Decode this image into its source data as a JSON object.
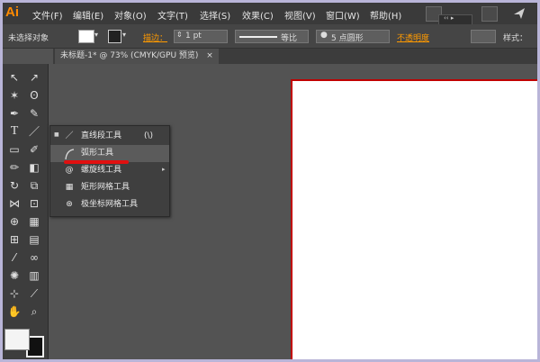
{
  "app": {
    "logo": "Ai",
    "cc_top": "‹‹ ▸",
    "cc_icon_label": "∞"
  },
  "menu": {
    "items": [
      "文件(F)",
      "编辑(E)",
      "对象(O)",
      "文字(T)",
      "选择(S)",
      "效果(C)",
      "视图(V)",
      "窗口(W)",
      "帮助(H)"
    ]
  },
  "control_bar": {
    "selection_status": "未选择对象",
    "stroke_label": "描边：",
    "stroke_value": "1 pt",
    "profile_label": "等比",
    "brush_label": "5 点圆形",
    "opacity_label": "不透明度",
    "style_label": "样式："
  },
  "document_tab": {
    "title": "未标题-1* @ 73% (CMYK/GPU 预览)",
    "close": "×"
  },
  "flyout": {
    "items": [
      {
        "label": "直线段工具",
        "shortcut": "(\\)",
        "icon": "line-segment-icon"
      },
      {
        "label": "弧形工具",
        "shortcut": "",
        "icon": "arc-icon"
      },
      {
        "label": "螺旋线工具",
        "shortcut": "",
        "icon": "spiral-icon"
      },
      {
        "label": "矩形网格工具",
        "shortcut": "",
        "icon": "rectangular-grid-icon"
      },
      {
        "label": "极坐标网格工具",
        "shortcut": "",
        "icon": "polar-grid-icon"
      }
    ]
  },
  "colors": {
    "accent": "#ff8a00",
    "highlight_underline": "#e01010",
    "artboard_border": "#c00000"
  }
}
